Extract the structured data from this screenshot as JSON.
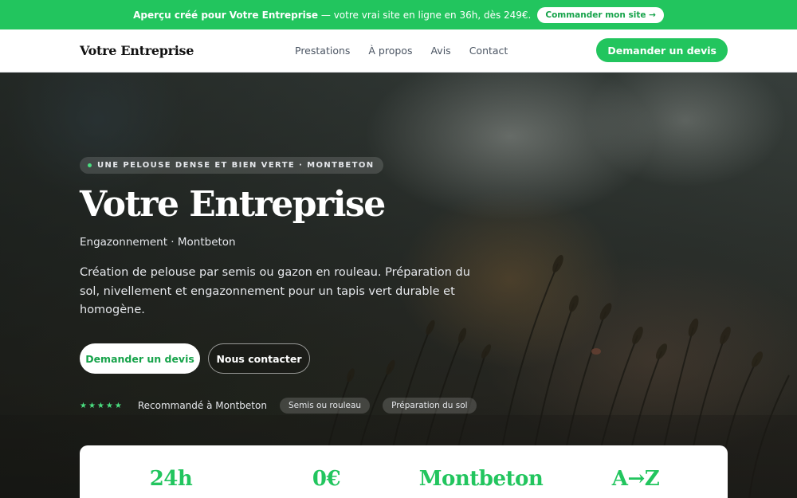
{
  "promo": {
    "highlight": "Aperçu créé pour Votre Entreprise",
    "text": " — votre vrai site en ligne en 36h, dès 249€.",
    "button": "Commander mon site →"
  },
  "nav": {
    "brand": "Votre Entreprise",
    "links": [
      "Prestations",
      "À propos",
      "Avis",
      "Contact"
    ],
    "cta": "Demander un devis"
  },
  "hero": {
    "eyebrow": "UNE PELOUSE DENSE ET BIEN VERTE · MONTBETON",
    "title": "Votre Entreprise",
    "subtitle": "Engazonnement · Montbeton",
    "description": "Création de pelouse par semis ou gazon en rouleau. Préparation du sol, nivellement et engazonnement pour un tapis vert durable et homogène.",
    "primary_button": "Demander un devis",
    "secondary_button": "Nous contacter",
    "stars": "★★★★★",
    "recommendation": "Recommandé à Montbeton",
    "chips": [
      "Semis ou rouleau",
      "Préparation du sol"
    ]
  },
  "stats": [
    "24h",
    "0€",
    "Montbeton",
    "A→Z"
  ],
  "colors": {
    "accent": "#22c55e",
    "accent_dark": "#16a34a"
  }
}
